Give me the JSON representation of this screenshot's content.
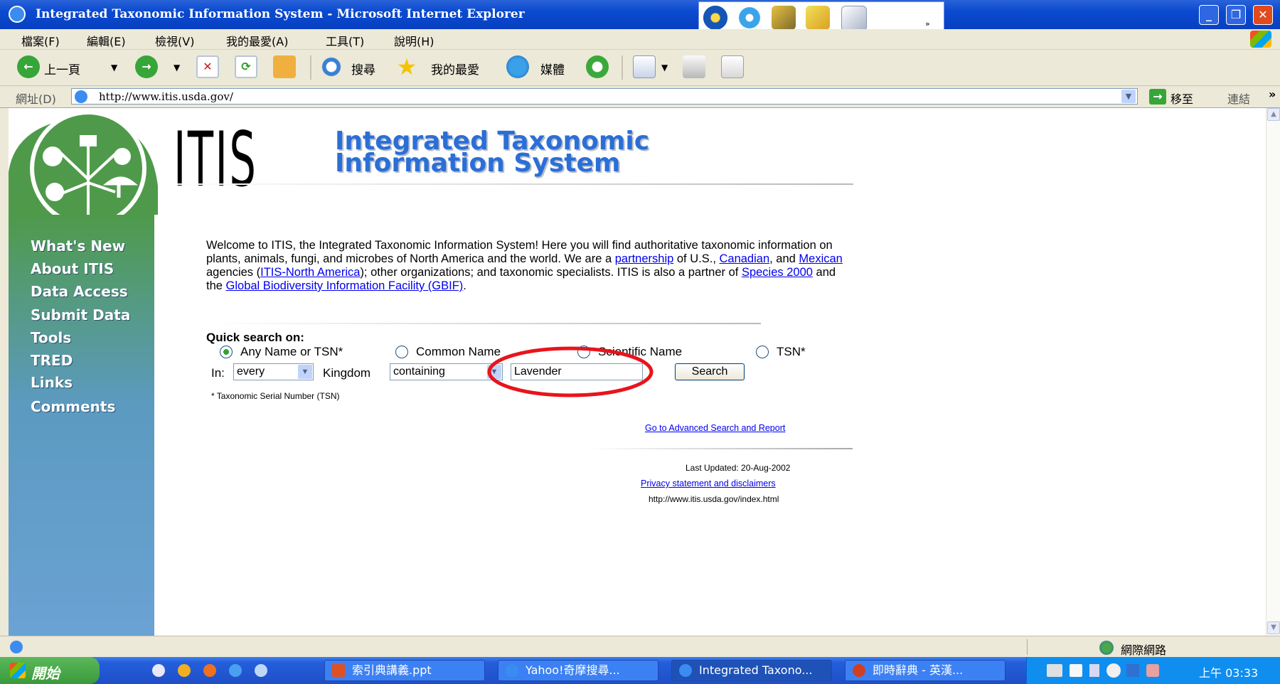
{
  "window": {
    "title": "Integrated Taxonomic Information System - Microsoft Internet Explorer"
  },
  "menu": [
    "檔案(F)",
    "編輯(E)",
    "檢視(V)",
    "我的最愛(A)",
    "工具(T)",
    "說明(H)"
  ],
  "toolbar": {
    "back": "上一頁",
    "search": "搜尋",
    "favorites": "我的最愛",
    "media": "媒體"
  },
  "address": {
    "label": "網址(D)",
    "url": "http://www.itis.usda.gov/",
    "go": "移至",
    "links": "連結"
  },
  "page": {
    "logo_text": "ITIS",
    "logo_line1": "Integrated Taxonomic",
    "logo_line2": "Information System",
    "nav": [
      "What's New",
      "About ITIS",
      "Data Access",
      "Submit Data",
      "Tools",
      "TRED",
      "Links",
      "Comments"
    ],
    "welcome": {
      "t1": "Welcome to ITIS, the Integrated Taxonomic Information System! Here you will find authoritative taxonomic information on plants, animals, fungi, and microbes of North America and the world. We are a ",
      "l1": "partnership",
      "t2": " of U.S., ",
      "l2": "Canadian",
      "t3": ", and ",
      "l3": "Mexican",
      "t4": " agencies (",
      "l4": "ITIS-North America",
      "t5": "); other organizations; and taxonomic specialists. ITIS is also a partner of ",
      "l5": "Species 2000",
      "t6": " and the ",
      "l6": "Global Biodiversity Information Facility (GBIF)",
      "t7": "."
    },
    "quick_search": {
      "label": "Quick search on:",
      "options": [
        "Any Name or TSN*",
        "Common Name",
        "Scientific Name",
        "TSN*"
      ],
      "selected": "Any Name or TSN*",
      "in_label": "In:",
      "kingdom_select": "every",
      "kingdom_label": "Kingdom",
      "match_select": "containing",
      "query": "Lavender",
      "button": "Search",
      "footnote": "* Taxonomic Serial Number (TSN)"
    },
    "advanced_link": "Go to Advanced Search and Report",
    "last_updated": "Last Updated: 20-Aug-2002",
    "privacy_link": "Privacy statement and disclaimers",
    "page_url": "http://www.itis.usda.gov/index.html"
  },
  "status": {
    "zone": "網際網路"
  },
  "taskbar": {
    "start": "開始",
    "tasks": [
      "索引典講義.ppt",
      "Yahoo!奇摩搜尋...",
      "Integrated Taxono...",
      "即時辭典 - 英漢..."
    ],
    "clock": "上午 03:33"
  },
  "colors": {
    "accent_blue": "#2b6fd6",
    "highlight_circle": "#e8141c",
    "sidebar_green": "#4e9a4a",
    "sidebar_blue": "#6aa2d4"
  }
}
